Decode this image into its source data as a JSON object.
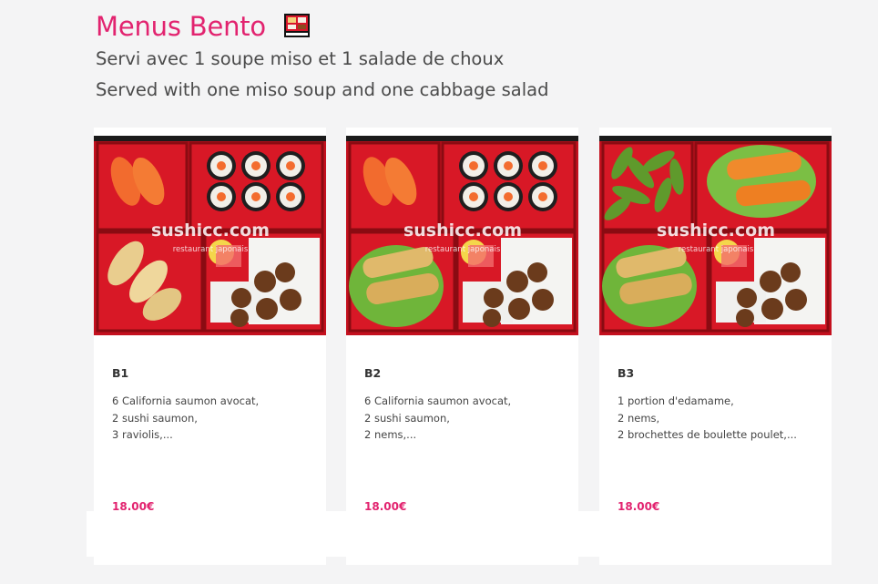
{
  "header": {
    "title": "Menus Bento",
    "subtitle_fr": "Servi avec 1 soupe miso et 1 salade de choux",
    "subtitle_en": "Served with one miso soup and one cabbage salad",
    "icon": "bento-box-icon"
  },
  "watermark": "sushicc.com",
  "watermark_sub": "restaurant japonais",
  "accent_color": "#e2236f",
  "items": [
    {
      "code": "B1",
      "lines": [
        "6 California saumon avocat,",
        "2 sushi saumon,",
        "3 raviolis,..."
      ],
      "price": "18.00€"
    },
    {
      "code": "B2",
      "lines": [
        "6 California saumon avocat,",
        "2 sushi saumon,",
        "2 nems,..."
      ],
      "price": "18.00€"
    },
    {
      "code": "B3",
      "lines": [
        "1 portion d'edamame,",
        "2 nems,",
        "2 brochettes de boulette poulet,..."
      ],
      "price": "18.00€"
    }
  ]
}
